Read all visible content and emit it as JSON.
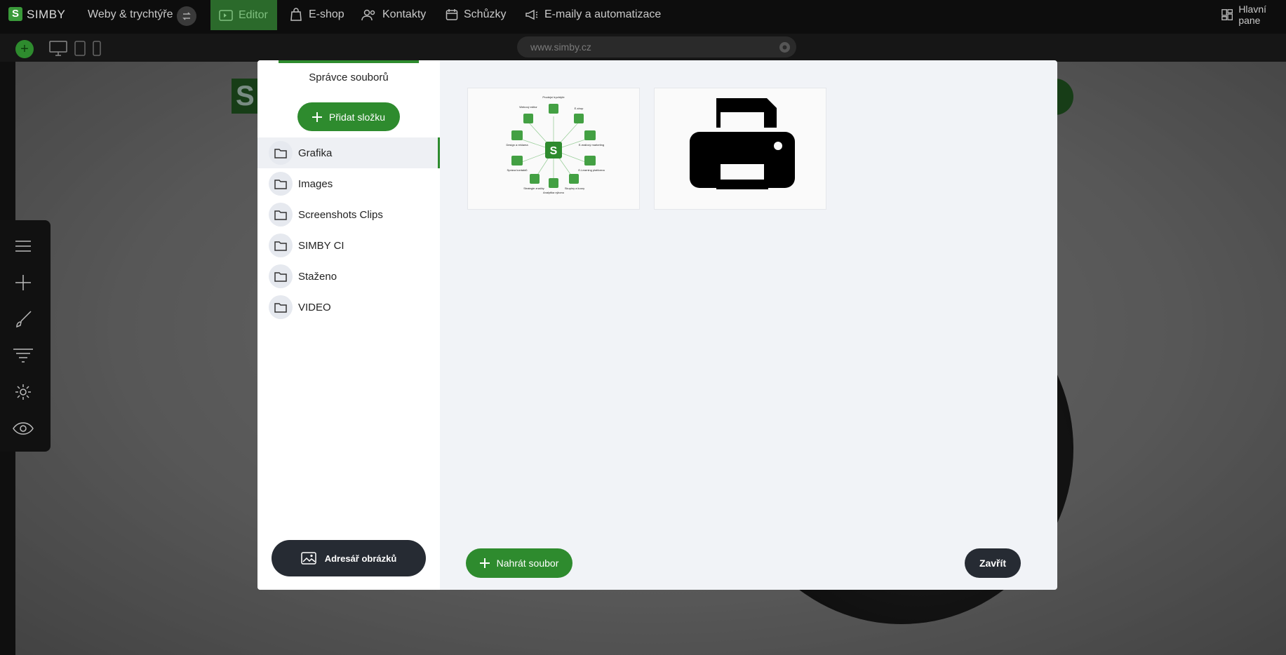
{
  "topbar": {
    "logo_letter": "S",
    "app_name": "SIMBY",
    "project": "Weby & trychtýře",
    "nav": [
      {
        "label": "Editor",
        "icon": "editor-icon"
      },
      {
        "label": "E-shop",
        "icon": "shopping-bag-icon"
      },
      {
        "label": "Kontakty",
        "icon": "contacts-icon"
      },
      {
        "label": "Schůzky",
        "icon": "calendar-icon"
      },
      {
        "label": "E-maily a automatizace",
        "icon": "megaphone-icon"
      }
    ],
    "dashboard": "Hlavní pane"
  },
  "subbar": {
    "add": "+",
    "url": "www.simby.cz"
  },
  "modal": {
    "title": "Správce souborů",
    "add_folder": "Přidat složku",
    "folders": [
      {
        "label": "Grafika",
        "active": true
      },
      {
        "label": "Images"
      },
      {
        "label": "Screenshots Clips"
      },
      {
        "label": "SIMBY CI"
      },
      {
        "label": "Staženo"
      },
      {
        "label": "VIDEO"
      }
    ],
    "image_directory": "Adresář obrázků",
    "upload": "Nahrát soubor",
    "close": "Zavřít"
  },
  "thumb_1_labels": {
    "center": "S",
    "top": "Prodejní trychtýře",
    "topleft": "Webový editor",
    "topright": "E-shop",
    "left": "Design a reklama",
    "right": "E-mailový marketing",
    "lowleft": "Správa kontaktů",
    "lowright": "E-Learning platforma",
    "bottom": "Analytika výkonu",
    "bottomleft": "Strategie značky",
    "bottomright": "Skupiny a kurzy"
  },
  "colors": {
    "accent": "#2e8b2e",
    "dark_button": "#262b33",
    "topbar": "#0d0d0d"
  }
}
